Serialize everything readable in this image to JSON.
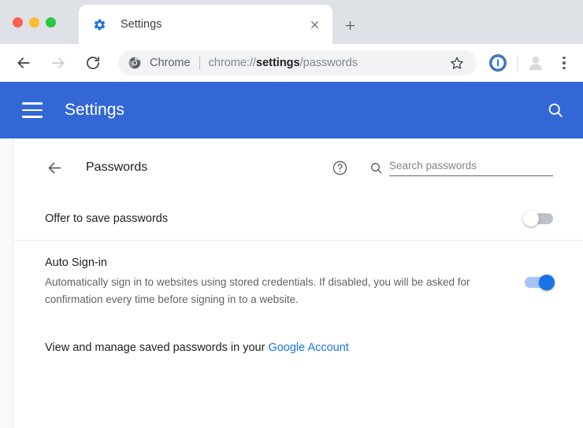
{
  "window": {
    "traffic_lights": [
      "close",
      "minimize",
      "maximize"
    ]
  },
  "tabstrip": {
    "tab": {
      "favicon": "gear-icon",
      "title": "Settings",
      "close_label": "×"
    },
    "new_tab_label": "+"
  },
  "toolbar": {
    "back_icon": "back-arrow-icon",
    "forward_icon": "forward-arrow-icon",
    "reload_icon": "reload-icon",
    "omnibox": {
      "site_icon": "chrome-logo-icon",
      "chip_label": "Chrome",
      "url_prefix": "chrome://",
      "url_bold": "settings",
      "url_suffix": "/passwords",
      "full_url": "chrome://settings/passwords",
      "bookmark_icon": "star-icon"
    },
    "extension_icon": "onepassword-extension-icon",
    "profile_icon": "profile-avatar-icon",
    "menu_icon": "three-dot-menu-icon"
  },
  "settings_header": {
    "menu_icon": "hamburger-menu-icon",
    "title": "Settings",
    "search_icon": "search-icon",
    "background_color": "#3367d6"
  },
  "passwords_page": {
    "back_icon": "back-arrow-icon",
    "title": "Passwords",
    "help_icon": "help-circle-icon",
    "search": {
      "icon": "search-icon",
      "placeholder": "Search passwords",
      "value": ""
    },
    "settings": [
      {
        "name": "offer-to-save-passwords",
        "label": "Offer to save passwords",
        "description": "",
        "toggle_state": "off"
      },
      {
        "name": "auto-sign-in",
        "label": "Auto Sign-in",
        "description": "Automatically sign in to websites using stored credentials. If disabled, you will be asked for confirmation every time before signing in to a website.",
        "toggle_state": "on"
      }
    ],
    "manage": {
      "text": "View and manage saved passwords in your ",
      "link_label": "Google Account",
      "link_color": "#1a73e8"
    }
  }
}
